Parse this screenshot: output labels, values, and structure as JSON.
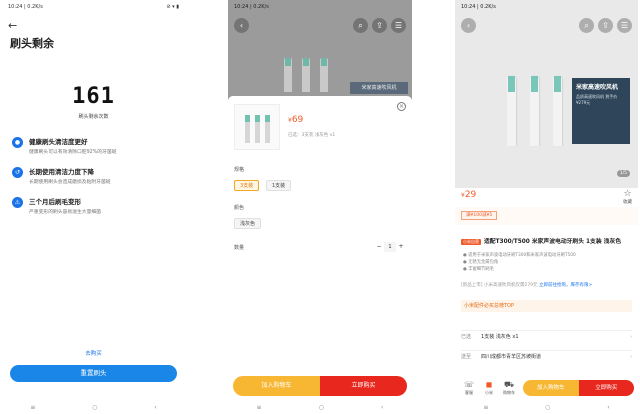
{
  "screen1": {
    "status_left": "10:24 | 0.2K/s",
    "status_right": "⊘ ▾ ▮",
    "back_icon": "←",
    "title": "刷头剩余",
    "counter": "161",
    "counter_caption": "刷头剩余次数",
    "features": [
      {
        "icon": "●",
        "title": "健康刷头清洁度更好",
        "desc": "健康刷头可以有效清除口腔92%的牙菌斑"
      },
      {
        "icon": "↺",
        "title": "长期使用清洁力度下降",
        "desc": "长期使用刷头会造成磨损及粘附牙菌斑"
      },
      {
        "icon": "⚠",
        "title": "三个月后刷毛变形",
        "desc": "严重变形的刷头容易滋生大量细菌"
      }
    ],
    "buy_link": "去购买",
    "reset_button": "重置刷头"
  },
  "screen2": {
    "status_left": "10:24 | 0.2K/s",
    "banner": "米家高速吹风机",
    "price_currency": "¥",
    "price": "69",
    "selected": "已选：3支装 浅灰色 x1",
    "spec_label": "规格",
    "spec_options": [
      "3支装",
      "1支装"
    ],
    "color_label": "颜色",
    "color_options": [
      "浅灰色"
    ],
    "qty_label": "数量",
    "qty_minus": "−",
    "qty_value": "1",
    "qty_plus": "+",
    "add_to_cart": "加入购物车",
    "buy_now": "立即购买",
    "close_icon": "×"
  },
  "screen3": {
    "status_left": "10:24 | 0.2K/s",
    "banner_title": "米家高速吹风机",
    "banner_sub": "品质高速吹风机 到手价 ¥279元",
    "pager": "1/5",
    "price_currency": "¥",
    "price": "29",
    "coupon": "满¥100减¥5",
    "favorite": "收藏",
    "tag": "小米自营",
    "product_title": "适配T300/T500 米家声波电动牙刷头 1支装 浅灰色",
    "desc_lines": [
      "● 适用于米家声波电动牙刷T300和米家声波电动牙刷T500",
      "● 无锈无金属包角",
      "● 丰富细节刷毛"
    ],
    "promo_label": "[新品上市]",
    "promo_text": "小米高速吹风机仅需279元",
    "promo_link": "立即前往抢购，库存有限>",
    "top_list": "小米配件必买总榜TOP",
    "row_selected_key": "已选",
    "row_selected_val": "1支装 浅灰色 x1",
    "row_ship_key": "送至",
    "row_ship_val": "四川成都市青羊区苏坡街道",
    "bottom_service": "客服",
    "bottom_store": "小米",
    "bottom_cart": "购物车",
    "add_to_cart": "加入购物车",
    "buy_now": "立即购买"
  },
  "system_nav": [
    "≡",
    "○",
    "‹"
  ],
  "colors": {
    "blue": "#1a86e8",
    "orange": "#f05a28",
    "yellow": "#f7b733",
    "red": "#e8281f"
  }
}
